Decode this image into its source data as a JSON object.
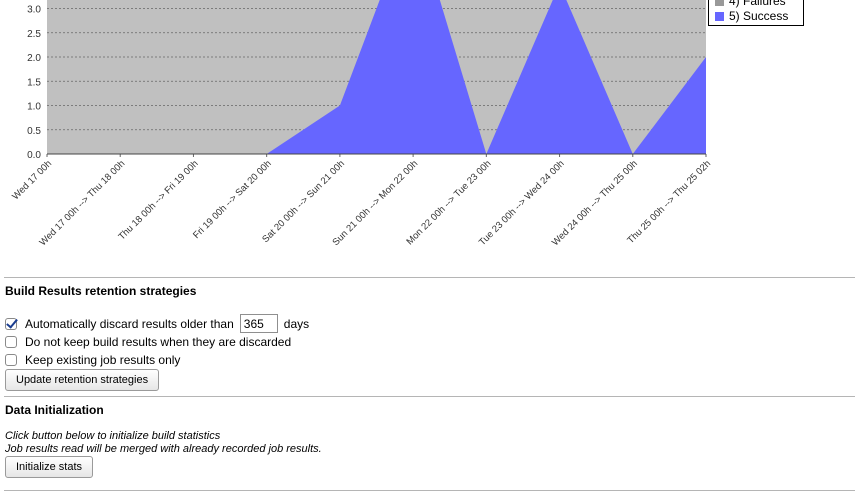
{
  "chart_data": {
    "type": "area",
    "categories": [
      "Wed 17 00h",
      "Wed 17 00h --> Thu 18 00h",
      "Thu 18 00h --> Fri 19 00h",
      "Fri 19 00h --> Sat 20 00h",
      "Sat 20 00h --> Sun 21 00h",
      "Sun 21 00h --> Mon 22 00h",
      "Mon 22 00h --> Tue 23 00h",
      "Tue 23 00h --> Wed 24 00h",
      "Wed 24 00h --> Thu 25 00h",
      "Thu 25 00h --> Thu 25 02h"
    ],
    "series": [
      {
        "name": "5) Success",
        "values": [
          0,
          0,
          0,
          0,
          1,
          5,
          0,
          3.5,
          0,
          2
        ]
      }
    ],
    "ylim": [
      0,
      3.0
    ],
    "yticks": [
      "0.0",
      "0.5",
      "1.0",
      "1.5",
      "2.0",
      "2.5",
      "3.0"
    ],
    "grid": true,
    "colors": {
      "plot_bg": "#c0c0c0",
      "success": "#6666ff",
      "failures": "#999999"
    },
    "legend_items": [
      {
        "label": "4) Failures",
        "color": "#999999"
      },
      {
        "label": "5) Success",
        "color": "#6666ff"
      }
    ],
    "legend_position": "top-right"
  },
  "retention": {
    "title": "Build Results retention strategies",
    "option_discard_label": "Automatically discard results older than",
    "option_discard_checked": true,
    "days_value": "365",
    "days_unit": "days",
    "option_no_keep_label": "Do not keep build results when they are discarded",
    "option_no_keep_checked": false,
    "option_keep_existing_label": "Keep existing job results only",
    "option_keep_existing_checked": false,
    "update_button": "Update retention strategies"
  },
  "init": {
    "title": "Data Initialization",
    "line1": "Click button below to initialize build statistics",
    "line2": "Job results read will be merged with already recorded job results.",
    "button": "Initialize stats"
  }
}
